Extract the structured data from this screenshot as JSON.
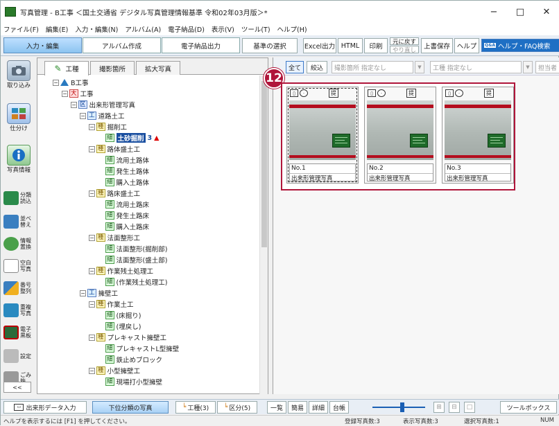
{
  "window": {
    "title": "写真管理 - B工事 ＜国土交通省 デジタル写真管理情報基準 令和02年03月版＞*",
    "minimize": "−",
    "maximize": "□",
    "close": "✕"
  },
  "menu": [
    "ファイル(F)",
    "編集(E)",
    "入力・編集(N)",
    "アルバム(A)",
    "電子納品(D)",
    "表示(V)",
    "ツール(T)",
    "ヘルプ(H)"
  ],
  "modetabs": [
    "入力・編集",
    "アルバム作成",
    "電子納品出力"
  ],
  "toolbar": {
    "kijun": "基準の選択",
    "excel": "Excel出力",
    "html": "HTML",
    "print": "印刷",
    "undo": "元に戻す",
    "redo": "やり直し",
    "save": "上書保存",
    "help": "ヘルプ",
    "help_search": "ヘルプ・FAQ検索",
    "qa_icon": "Q&A"
  },
  "sidebar": {
    "items": [
      "取り込み",
      "仕分け",
      "写真情報"
    ],
    "rows": [
      {
        "icon": "classify-icon",
        "label1": "分類",
        "label2": "読込",
        "color": "#2a8a4a"
      },
      {
        "icon": "sort-icon",
        "label1": "並べ",
        "label2": "替え",
        "color": "#3a7fc0"
      },
      {
        "icon": "replace-icon",
        "label1": "情報",
        "label2": "置換",
        "color": "#4aa04a"
      },
      {
        "icon": "blank-photo-icon",
        "label1": "空白",
        "label2": "写真",
        "color": "#888888"
      },
      {
        "icon": "renumber-icon",
        "label1": "番号",
        "label2": "整列",
        "color": "#d08020"
      },
      {
        "icon": "duplicate-icon",
        "label1": "重複",
        "label2": "写真",
        "color": "#2a8ac0"
      },
      {
        "icon": "blackboard-icon",
        "label1": "電子",
        "label2": "黒板",
        "color": "#2a6a3a"
      },
      {
        "icon": "settings-icon",
        "label1": "設定",
        "label2": "",
        "color": "#666666"
      },
      {
        "icon": "trash-icon",
        "label1": "ごみ",
        "label2": "箱",
        "color": "#777777"
      }
    ],
    "collapse": "<<"
  },
  "tree_tabs": [
    "工種",
    "撮影箇所",
    "拡大写真"
  ],
  "tree": [
    {
      "depth": 0,
      "badge": "",
      "label": "B工事",
      "exp": "−"
    },
    {
      "depth": 1,
      "badge": "大",
      "label": "工事",
      "exp": "−"
    },
    {
      "depth": 2,
      "badge": "区",
      "label": "出来形管理写真",
      "exp": "−"
    },
    {
      "depth": 3,
      "badge": "工",
      "label": "道路土工",
      "exp": "−"
    },
    {
      "depth": 4,
      "badge": "種",
      "label": "掘削工",
      "exp": "−"
    },
    {
      "depth": 5,
      "badge": "細",
      "label": "土砂掘削",
      "exp": "",
      "sel": true,
      "count": "3",
      "warn": "▲"
    },
    {
      "depth": 4,
      "badge": "種",
      "label": "路体盛土工",
      "exp": "−"
    },
    {
      "depth": 5,
      "badge": "細",
      "label": "流用土路体",
      "exp": ""
    },
    {
      "depth": 5,
      "badge": "細",
      "label": "発生土路体",
      "exp": ""
    },
    {
      "depth": 5,
      "badge": "細",
      "label": "購入土路体",
      "exp": ""
    },
    {
      "depth": 4,
      "badge": "種",
      "label": "路床盛土工",
      "exp": "−"
    },
    {
      "depth": 5,
      "badge": "細",
      "label": "流用土路床",
      "exp": ""
    },
    {
      "depth": 5,
      "badge": "細",
      "label": "発生土路床",
      "exp": ""
    },
    {
      "depth": 5,
      "badge": "細",
      "label": "購入土路床",
      "exp": ""
    },
    {
      "depth": 4,
      "badge": "種",
      "label": "法面整形工",
      "exp": "−"
    },
    {
      "depth": 5,
      "badge": "細",
      "label": "法面整形(掘削部)",
      "exp": ""
    },
    {
      "depth": 5,
      "badge": "細",
      "label": "法面整形(盛土部)",
      "exp": ""
    },
    {
      "depth": 4,
      "badge": "種",
      "label": "作業残土処理工",
      "exp": "−"
    },
    {
      "depth": 5,
      "badge": "細",
      "label": "(作業残土処理工)",
      "exp": ""
    },
    {
      "depth": 3,
      "badge": "工",
      "label": "擁壁工",
      "exp": "−"
    },
    {
      "depth": 4,
      "badge": "種",
      "label": "作業土工",
      "exp": "−"
    },
    {
      "depth": 5,
      "badge": "細",
      "label": "(床掘り)",
      "exp": ""
    },
    {
      "depth": 5,
      "badge": "細",
      "label": "(埋戻し)",
      "exp": ""
    },
    {
      "depth": 4,
      "badge": "種",
      "label": "プレキャスト擁壁工",
      "exp": "−"
    },
    {
      "depth": 5,
      "badge": "細",
      "label": "プレキャストL型擁壁",
      "exp": ""
    },
    {
      "depth": 5,
      "badge": "細",
      "label": "鉄止めブロック",
      "exp": ""
    },
    {
      "depth": 4,
      "badge": "種",
      "label": "小型擁壁工",
      "exp": "−"
    },
    {
      "depth": 5,
      "badge": "細",
      "label": "現場打小型擁壁",
      "exp": ""
    }
  ],
  "filter": {
    "all": "全て",
    "narrow": "絞込",
    "place_placeholder": "撮影箇所 指定なし",
    "kind_placeholder": "工種 指定なし",
    "person_placeholder": "担当者"
  },
  "callout": "12",
  "photos": [
    {
      "no": "No.1",
      "category": "出来形管理写真",
      "selected": true
    },
    {
      "no": "No.2",
      "category": "出来形管理写真",
      "selected": false
    },
    {
      "no": "No.3",
      "category": "出来形管理写真",
      "selected": false
    }
  ],
  "card_icon_label": "提",
  "bottom": {
    "input": "出来形データ入力",
    "lower": "下位分類の写真",
    "koshu": "工種(3)",
    "kubun": "区分(5)",
    "list": "一覧",
    "simple": "簡易",
    "detail": "詳細",
    "ledger": "台帳",
    "toolbox": "ツールボックス"
  },
  "status": {
    "help": "ヘルプを表示するには [F1] を押してください。",
    "registered": "登録写真数:3",
    "shown": "表示写真数:3",
    "selected": "選択写真数:1",
    "num": "NUM"
  }
}
